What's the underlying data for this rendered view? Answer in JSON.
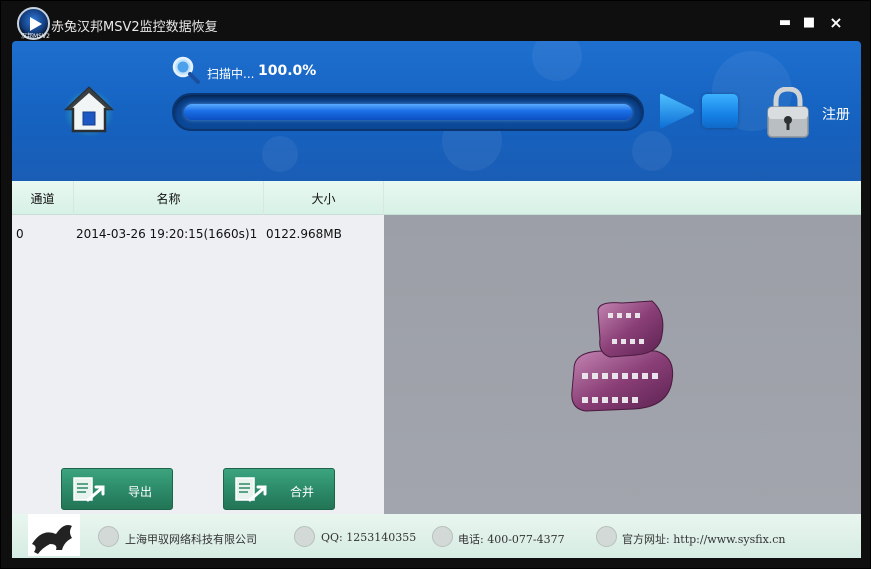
{
  "window": {
    "title": "赤兔汉邦MSV2监控数据恢复",
    "logo_text": "汉邦MSV2",
    "minimize_label": "▬",
    "maximize_label": "■",
    "close_label": "×"
  },
  "header": {
    "scan_label": "扫描中...",
    "scan_percent_text": "100.0%",
    "progress": 1.0,
    "register_label": "注册"
  },
  "table": {
    "columns": [
      "通道",
      "名称",
      "大小"
    ],
    "rows": [
      {
        "channel": "0",
        "name": "2014-03-26 19:20:15(1660s)1",
        "size": "0122.968MB"
      }
    ]
  },
  "buttons": {
    "export_label": "导出",
    "merge_label": "合并"
  },
  "footer": {
    "company": "上海甲驭网络科技有限公司",
    "qq": "QQ: 1253140355",
    "phone": "电话: 400-077-4377",
    "website": "官方网址: http://www.sysfix.cn"
  },
  "colors": {
    "header_blue": "#1562c0",
    "button_green": "#2a8766",
    "list_header_mint": "#d7f1e6",
    "preview_gray": "#9c9fa7"
  }
}
